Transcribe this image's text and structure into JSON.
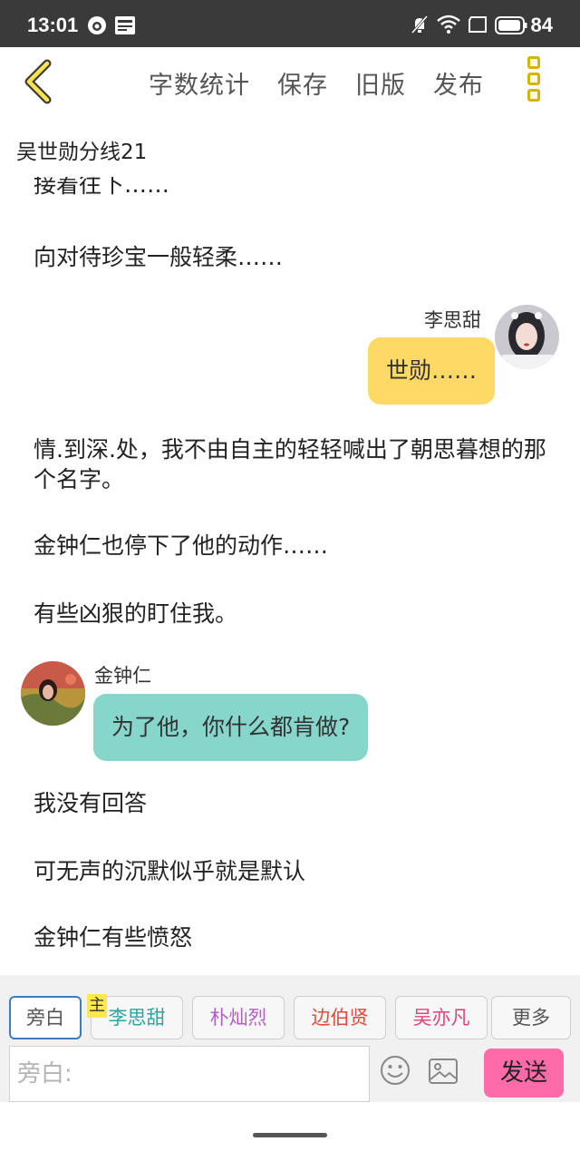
{
  "status_bar": {
    "time": "13:01",
    "battery": "84"
  },
  "toolbar": {
    "actions": [
      "字数统计",
      "保存",
      "旧版",
      "发布"
    ]
  },
  "document": {
    "title": "吴世勋分线21"
  },
  "content": {
    "top_partial": "接着往下……",
    "p1": "向对待珍宝一般轻柔……",
    "dialog1": {
      "speaker": "李思甜",
      "text": "世勋……"
    },
    "p2": "情.到深.处，我不由自主的轻轻喊出了朝思暮想的那个名字。",
    "p3": "金钟仁也停下了他的动作……",
    "p4": "有些凶狠的盯住我。",
    "dialog2": {
      "speaker": "金钟仁",
      "text": "为了他，你什么都肯做?"
    },
    "p5": "我没有回答",
    "p6": "可无声的沉默似乎就是默认",
    "p7": "金钟仁有些愤怒"
  },
  "editor": {
    "main_badge": "主",
    "chips": [
      {
        "label": "旁白",
        "color": "#666666"
      },
      {
        "label": "李思甜",
        "color": "#2aa6a0"
      },
      {
        "label": "朴灿烈",
        "color": "#b45cc8"
      },
      {
        "label": "边伯贤",
        "color": "#e24a3a"
      },
      {
        "label": "吴亦凡",
        "color": "#e0457a"
      },
      {
        "label": "更多",
        "color": "#555555"
      }
    ],
    "input_placeholder": "旁白:",
    "send_label": "发送"
  },
  "colors": {
    "bubble_right": "#ffd966",
    "bubble_left": "#86d6cc",
    "accent": "#ff6aa8",
    "back_arrow": "#d8b400"
  }
}
